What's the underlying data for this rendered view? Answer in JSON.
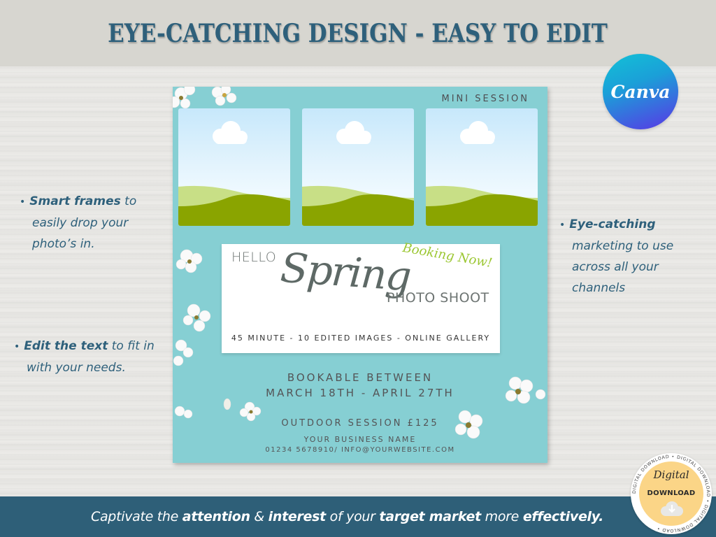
{
  "header": {
    "title": "EYE-CATCHING DESIGN - EASY TO EDIT"
  },
  "brand": {
    "logo_text": "Canva",
    "primary_color": "#2e607b",
    "flyer_bg": "#86cfd3"
  },
  "features": [
    {
      "bold": "Smart frames",
      "lines": [
        " to",
        "easily drop your",
        "photo’s in."
      ]
    },
    {
      "bold": "Edit the text",
      "lines": [
        " to fit in",
        "with your needs."
      ]
    },
    {
      "bold": "Eye-catching",
      "lines": [
        "marketing to use",
        "across all your",
        "channels"
      ]
    }
  ],
  "flyer": {
    "label": "MINI SESSION",
    "photo_frames": 3,
    "hello": "HELLO",
    "spring": "Spring",
    "booking": "Booking Now!",
    "photo_shoot": "PHOTO SHOOT",
    "details": "45 MINUTE - 10 EDITED IMAGES - ONLINE GALLERY",
    "bookable_line1": "BOOKABLE BETWEEN",
    "bookable_line2": "MARCH 18TH - APRIL 27TH",
    "price": "OUTDOOR SESSION £125",
    "business_name": "YOUR BUSINESS NAME",
    "contact": "01234 5678910/ INFO@YOURWEBSITE.COM"
  },
  "footer": {
    "parts": [
      {
        "text": "Captivate the ",
        "bold": false
      },
      {
        "text": "attention",
        "bold": true
      },
      {
        "text": " & ",
        "bold": false
      },
      {
        "text": "interest",
        "bold": true
      },
      {
        "text": " of your ",
        "bold": false
      },
      {
        "text": "target market",
        "bold": true
      },
      {
        "text": " more ",
        "bold": false
      },
      {
        "text": "effectively.",
        "bold": true
      }
    ]
  },
  "badge": {
    "script": "Digital",
    "label": "DOWNLOAD",
    "ring_text": "DIGITAL DOWNLOAD • DIGITAL DOWNLOAD • DIGITAL DOWNLOAD •",
    "icon": "cloud-download-icon"
  }
}
